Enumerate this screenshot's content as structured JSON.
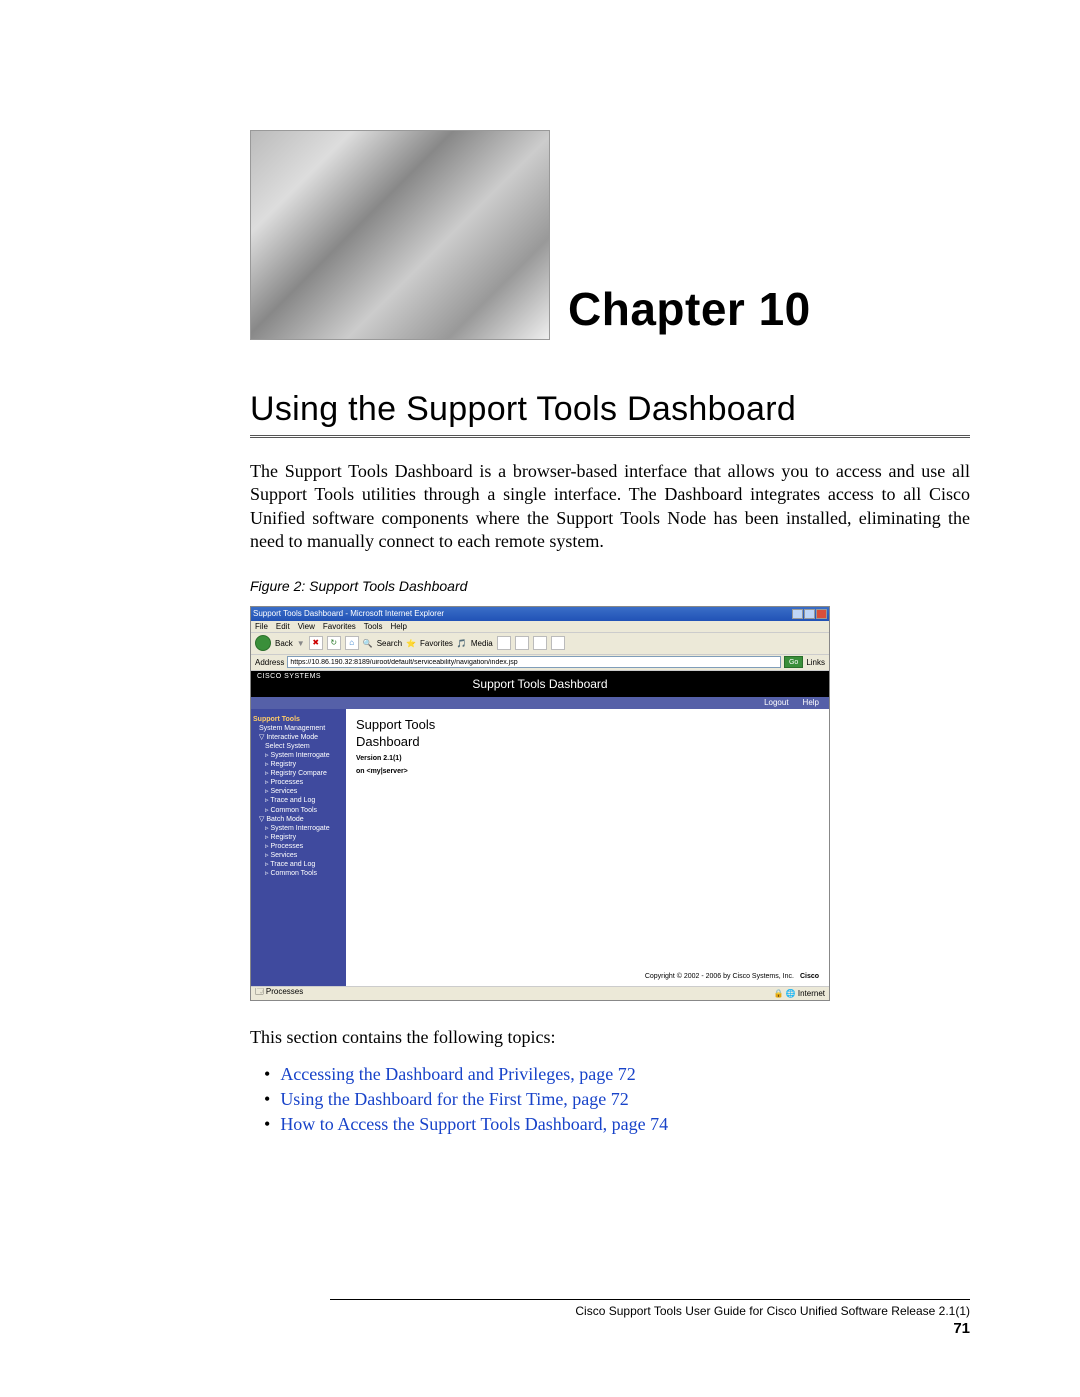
{
  "chapter": {
    "label": "Chapter 10"
  },
  "section": {
    "title": "Using the Support Tools Dashboard"
  },
  "intro": "The Support Tools Dashboard is a browser-based interface that allows you to access and use all Support Tools utilities through a single interface. The Dashboard integrates access to all Cisco Unified software components where the Support Tools Node has been installed, eliminating the need to manually connect to each remote system.",
  "figure": {
    "caption": "Figure 2: Support Tools Dashboard",
    "ie": {
      "title": "Support Tools Dashboard - Microsoft Internet Explorer",
      "menu": [
        "File",
        "Edit",
        "View",
        "Favorites",
        "Tools",
        "Help"
      ],
      "back": "Back",
      "search": "Search",
      "favorites": "Favorites",
      "media": "Media",
      "address_label": "Address",
      "address_value": "https://10.86.190.32:8189/uiroot/default/serviceability/navigation/index.jsp",
      "go": "Go",
      "links": "Links",
      "status_left": "Processes",
      "status_right": "Internet"
    },
    "dashboard": {
      "logo": "CISCO SYSTEMS",
      "header": "Support Tools Dashboard",
      "subbar": [
        "Logout",
        "Help"
      ],
      "side": {
        "root": "Support Tools",
        "groups": [
          {
            "name": "System Management",
            "items": []
          },
          {
            "name": "Interactive Mode",
            "items": [
              "Select System",
              "System Interrogate",
              "Registry",
              "Registry Compare",
              "Processes",
              "Services",
              "Trace and Log",
              "Common Tools"
            ]
          },
          {
            "name": "Batch Mode",
            "items": [
              "System Interrogate",
              "Registry",
              "Processes",
              "Services",
              "Trace and Log",
              "Common Tools"
            ]
          }
        ]
      },
      "content": {
        "title1": "Support Tools",
        "title2": "Dashboard",
        "version": "Version 2.1(1)",
        "on": "on <my|server>",
        "copyright": "Copyright © 2002 - 2006 by Cisco Systems, Inc.",
        "powered": "Cisco"
      }
    }
  },
  "topics": {
    "intro": "This section contains the following topics:",
    "items": [
      "Accessing the Dashboard and Privileges, page 72",
      "Using the Dashboard for the First Time, page 72",
      "How to Access the Support Tools Dashboard, page 74"
    ]
  },
  "footer": {
    "title": "Cisco Support Tools User Guide for Cisco Unified Software Release 2.1(1)",
    "page": "71"
  }
}
